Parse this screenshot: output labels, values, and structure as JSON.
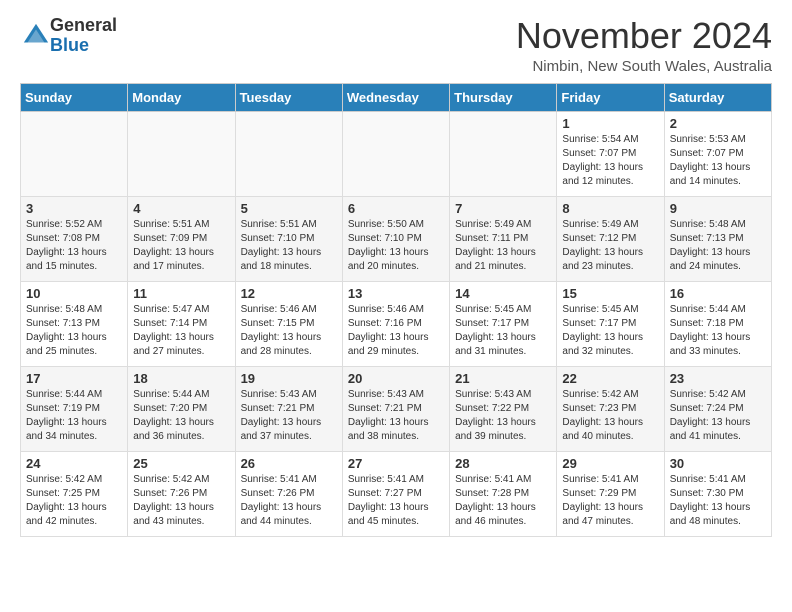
{
  "logo": {
    "general": "General",
    "blue": "Blue"
  },
  "title": "November 2024",
  "location": "Nimbin, New South Wales, Australia",
  "days_of_week": [
    "Sunday",
    "Monday",
    "Tuesday",
    "Wednesday",
    "Thursday",
    "Friday",
    "Saturday"
  ],
  "weeks": [
    [
      {
        "day": "",
        "info": ""
      },
      {
        "day": "",
        "info": ""
      },
      {
        "day": "",
        "info": ""
      },
      {
        "day": "",
        "info": ""
      },
      {
        "day": "",
        "info": ""
      },
      {
        "day": "1",
        "info": "Sunrise: 5:54 AM\nSunset: 7:07 PM\nDaylight: 13 hours\nand 12 minutes."
      },
      {
        "day": "2",
        "info": "Sunrise: 5:53 AM\nSunset: 7:07 PM\nDaylight: 13 hours\nand 14 minutes."
      }
    ],
    [
      {
        "day": "3",
        "info": "Sunrise: 5:52 AM\nSunset: 7:08 PM\nDaylight: 13 hours\nand 15 minutes."
      },
      {
        "day": "4",
        "info": "Sunrise: 5:51 AM\nSunset: 7:09 PM\nDaylight: 13 hours\nand 17 minutes."
      },
      {
        "day": "5",
        "info": "Sunrise: 5:51 AM\nSunset: 7:10 PM\nDaylight: 13 hours\nand 18 minutes."
      },
      {
        "day": "6",
        "info": "Sunrise: 5:50 AM\nSunset: 7:10 PM\nDaylight: 13 hours\nand 20 minutes."
      },
      {
        "day": "7",
        "info": "Sunrise: 5:49 AM\nSunset: 7:11 PM\nDaylight: 13 hours\nand 21 minutes."
      },
      {
        "day": "8",
        "info": "Sunrise: 5:49 AM\nSunset: 7:12 PM\nDaylight: 13 hours\nand 23 minutes."
      },
      {
        "day": "9",
        "info": "Sunrise: 5:48 AM\nSunset: 7:13 PM\nDaylight: 13 hours\nand 24 minutes."
      }
    ],
    [
      {
        "day": "10",
        "info": "Sunrise: 5:48 AM\nSunset: 7:13 PM\nDaylight: 13 hours\nand 25 minutes."
      },
      {
        "day": "11",
        "info": "Sunrise: 5:47 AM\nSunset: 7:14 PM\nDaylight: 13 hours\nand 27 minutes."
      },
      {
        "day": "12",
        "info": "Sunrise: 5:46 AM\nSunset: 7:15 PM\nDaylight: 13 hours\nand 28 minutes."
      },
      {
        "day": "13",
        "info": "Sunrise: 5:46 AM\nSunset: 7:16 PM\nDaylight: 13 hours\nand 29 minutes."
      },
      {
        "day": "14",
        "info": "Sunrise: 5:45 AM\nSunset: 7:17 PM\nDaylight: 13 hours\nand 31 minutes."
      },
      {
        "day": "15",
        "info": "Sunrise: 5:45 AM\nSunset: 7:17 PM\nDaylight: 13 hours\nand 32 minutes."
      },
      {
        "day": "16",
        "info": "Sunrise: 5:44 AM\nSunset: 7:18 PM\nDaylight: 13 hours\nand 33 minutes."
      }
    ],
    [
      {
        "day": "17",
        "info": "Sunrise: 5:44 AM\nSunset: 7:19 PM\nDaylight: 13 hours\nand 34 minutes."
      },
      {
        "day": "18",
        "info": "Sunrise: 5:44 AM\nSunset: 7:20 PM\nDaylight: 13 hours\nand 36 minutes."
      },
      {
        "day": "19",
        "info": "Sunrise: 5:43 AM\nSunset: 7:21 PM\nDaylight: 13 hours\nand 37 minutes."
      },
      {
        "day": "20",
        "info": "Sunrise: 5:43 AM\nSunset: 7:21 PM\nDaylight: 13 hours\nand 38 minutes."
      },
      {
        "day": "21",
        "info": "Sunrise: 5:43 AM\nSunset: 7:22 PM\nDaylight: 13 hours\nand 39 minutes."
      },
      {
        "day": "22",
        "info": "Sunrise: 5:42 AM\nSunset: 7:23 PM\nDaylight: 13 hours\nand 40 minutes."
      },
      {
        "day": "23",
        "info": "Sunrise: 5:42 AM\nSunset: 7:24 PM\nDaylight: 13 hours\nand 41 minutes."
      }
    ],
    [
      {
        "day": "24",
        "info": "Sunrise: 5:42 AM\nSunset: 7:25 PM\nDaylight: 13 hours\nand 42 minutes."
      },
      {
        "day": "25",
        "info": "Sunrise: 5:42 AM\nSunset: 7:26 PM\nDaylight: 13 hours\nand 43 minutes."
      },
      {
        "day": "26",
        "info": "Sunrise: 5:41 AM\nSunset: 7:26 PM\nDaylight: 13 hours\nand 44 minutes."
      },
      {
        "day": "27",
        "info": "Sunrise: 5:41 AM\nSunset: 7:27 PM\nDaylight: 13 hours\nand 45 minutes."
      },
      {
        "day": "28",
        "info": "Sunrise: 5:41 AM\nSunset: 7:28 PM\nDaylight: 13 hours\nand 46 minutes."
      },
      {
        "day": "29",
        "info": "Sunrise: 5:41 AM\nSunset: 7:29 PM\nDaylight: 13 hours\nand 47 minutes."
      },
      {
        "day": "30",
        "info": "Sunrise: 5:41 AM\nSunset: 7:30 PM\nDaylight: 13 hours\nand 48 minutes."
      }
    ]
  ]
}
